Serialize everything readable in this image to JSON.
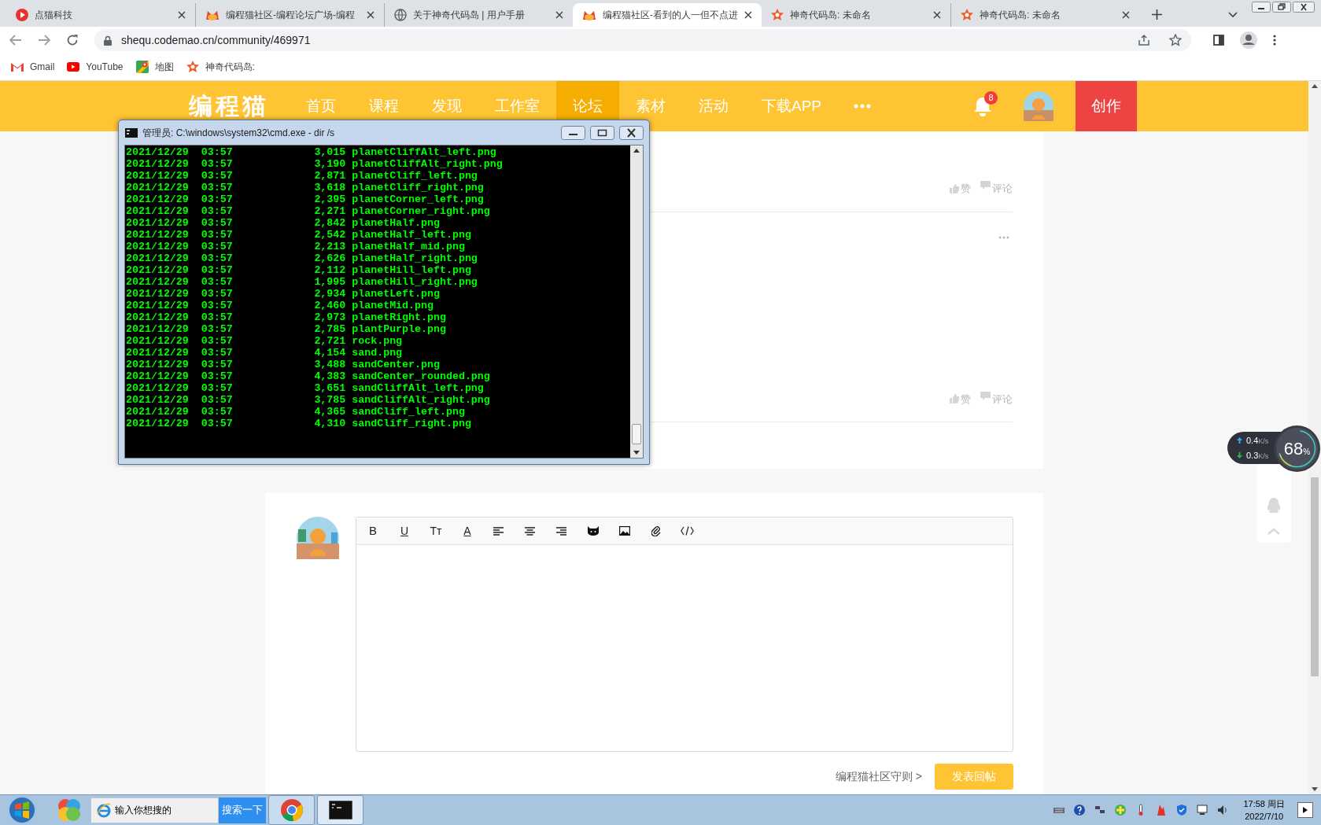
{
  "browser_tabs": [
    {
      "title": "点猫科技",
      "selected": false
    },
    {
      "title": "编程猫社区-编程论坛广场-编程",
      "selected": false
    },
    {
      "title": "关于神奇代码岛 | 用户手册",
      "selected": false
    },
    {
      "title": "编程猫社区-看到的人一但不点进",
      "selected": true
    },
    {
      "title": "神奇代码岛: 未命名",
      "selected": false
    },
    {
      "title": "神奇代码岛: 未命名",
      "selected": false
    }
  ],
  "address_bar": {
    "url": "shequ.codemao.cn/community/469971"
  },
  "bookmarks": [
    "Gmail",
    "YouTube",
    "地图",
    "神奇代码岛:"
  ],
  "site_nav": {
    "logo": "编程猫",
    "items": [
      {
        "label": "首页",
        "selected": false
      },
      {
        "label": "课程",
        "selected": false
      },
      {
        "label": "发现",
        "selected": false
      },
      {
        "label": "工作室",
        "selected": false
      },
      {
        "label": "论坛",
        "selected": true
      },
      {
        "label": "素材",
        "selected": false
      },
      {
        "label": "活动",
        "selected": false
      },
      {
        "label": "下载APP",
        "selected": false
      }
    ],
    "notification_count": "8",
    "create_button": "创作"
  },
  "post_actions": [
    {
      "like": "赞",
      "comment": "评论"
    },
    {
      "like": "赞",
      "comment": "评论"
    }
  ],
  "cmd_window": {
    "title": "管理员: C:\\windows\\system32\\cmd.exe - dir /s",
    "lines": [
      "2021/12/29  03:57             3,015 planetCliffAlt_left.png",
      "2021/12/29  03:57             3,190 planetCliffAlt_right.png",
      "2021/12/29  03:57             2,871 planetCliff_left.png",
      "2021/12/29  03:57             3,618 planetCliff_right.png",
      "2021/12/29  03:57             2,395 planetCorner_left.png",
      "2021/12/29  03:57             2,271 planetCorner_right.png",
      "2021/12/29  03:57             2,842 planetHalf.png",
      "2021/12/29  03:57             2,542 planetHalf_left.png",
      "2021/12/29  03:57             2,213 planetHalf_mid.png",
      "2021/12/29  03:57             2,626 planetHalf_right.png",
      "2021/12/29  03:57             2,112 planetHill_left.png",
      "2021/12/29  03:57             1,995 planetHill_right.png",
      "2021/12/29  03:57             2,934 planetLeft.png",
      "2021/12/29  03:57             2,460 planetMid.png",
      "2021/12/29  03:57             2,973 planetRight.png",
      "2021/12/29  03:57             2,785 plantPurple.png",
      "2021/12/29  03:57             2,721 rock.png",
      "2021/12/29  03:57             4,154 sand.png",
      "2021/12/29  03:57             3,488 sandCenter.png",
      "2021/12/29  03:57             4,383 sandCenter_rounded.png",
      "2021/12/29  03:57             3,651 sandCliffAlt_left.png",
      "2021/12/29  03:57             3,785 sandCliffAlt_right.png",
      "2021/12/29  03:57             4,365 sandCliff_left.png",
      "2021/12/29  03:57             4,310 sandCliff_right.png"
    ]
  },
  "editor": {
    "toolbar": [
      {
        "kind": "bold",
        "label": "B"
      },
      {
        "kind": "underline",
        "label": "U"
      },
      {
        "kind": "size",
        "label": "Tт"
      },
      {
        "kind": "color",
        "label": "A"
      },
      {
        "kind": "align-left"
      },
      {
        "kind": "align-center"
      },
      {
        "kind": "align-right"
      },
      {
        "kind": "cat"
      },
      {
        "kind": "image"
      },
      {
        "kind": "attach"
      },
      {
        "kind": "code"
      }
    ],
    "rules_link": "编程猫社区守则 >",
    "submit_button": "发表回帖"
  },
  "net_monitor": {
    "upload": "0.4",
    "upload_unit": "K/s",
    "download": "0.3",
    "download_unit": "K/s",
    "percent": "68",
    "percent_sign": "%"
  },
  "taskbar": {
    "search_placeholder": "输入你想搜的",
    "search_button": "搜索一下",
    "time": "17:58 周日",
    "date": "2022/7/10"
  }
}
